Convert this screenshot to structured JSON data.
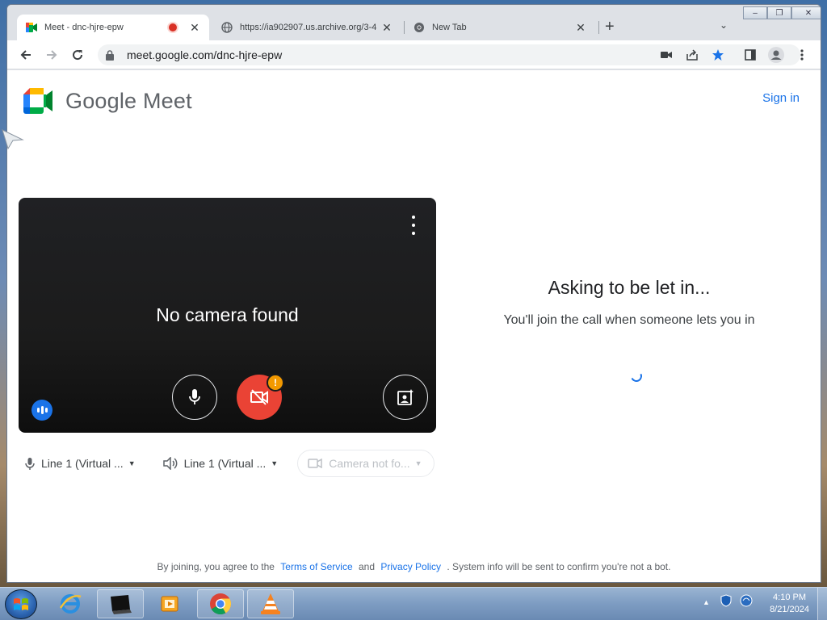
{
  "browser": {
    "tabs": [
      {
        "title": "Meet - dnc-hjre-epw",
        "active": true,
        "recording": true
      },
      {
        "title": "https://ia902907.us.archive.org/3-4",
        "active": false
      },
      {
        "title": "New Tab",
        "active": false
      }
    ],
    "new_tab_label": "+",
    "tab_list_label": "⌄",
    "url": "meet.google.com/dnc-hjre-epw",
    "window_controls": {
      "minimize": "–",
      "restore": "❐",
      "close": "✕"
    }
  },
  "meet": {
    "brand": "Google Meet",
    "sign_in": "Sign in",
    "preview": {
      "status": "No camera found",
      "warning_badge": "!"
    },
    "devices": {
      "microphone": "Line 1 (Virtual ...",
      "speaker": "Line 1 (Virtual ...",
      "camera": "Camera not fo..."
    },
    "asking": {
      "title": "Asking to be let in...",
      "subtitle": "You'll join the call when someone lets you in"
    },
    "footer": {
      "prefix": "By joining, you agree to the",
      "terms": "Terms of Service",
      "and": "and",
      "privacy": "Privacy Policy",
      "suffix": ". System info will be sent to confirm you're not a bot."
    }
  },
  "taskbar": {
    "clock_time": "4:10 PM",
    "clock_date": "8/21/2024",
    "tray_arrow": "▲"
  },
  "colors": {
    "accent": "#1a73e8",
    "camera_off": "#ea4335",
    "warning": "#f29900"
  }
}
